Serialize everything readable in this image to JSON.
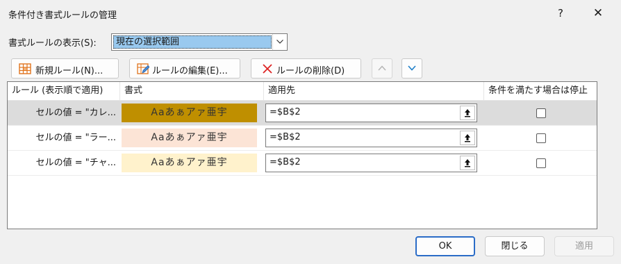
{
  "window": {
    "title": "条件付き書式ルールの管理",
    "help_label": "?",
    "close_label": "✕"
  },
  "show_rules": {
    "label": "書式ルールの表示(S):",
    "selected": "現在の選択範囲"
  },
  "toolbar": {
    "new_rule": "新規ルール(N)...",
    "edit_rule": "ルールの編集(E)...",
    "delete_rule": "ルールの削除(D)"
  },
  "columns": {
    "rule": "ルール (表示順で適用)",
    "format": "書式",
    "applies_to": "適用先",
    "stop_if_true": "条件を満たす場合は停止"
  },
  "rules": [
    {
      "name": "セルの値 = \"カレ...",
      "preview": "Aaあぁアァ亜宇",
      "bg": "#bf8f00",
      "applies_to": "=$B$2",
      "stop": false
    },
    {
      "name": "セルの値 = \"ラー...",
      "preview": "Aaあぁアァ亜宇",
      "bg": "#fce4d6",
      "applies_to": "=$B$2",
      "stop": false
    },
    {
      "name": "セルの値 = \"チャ...",
      "preview": "Aaあぁアァ亜宇",
      "bg": "#fff2cc",
      "applies_to": "=$B$2",
      "stop": false
    }
  ],
  "footer": {
    "ok": "OK",
    "close": "閉じる",
    "apply": "適用"
  }
}
